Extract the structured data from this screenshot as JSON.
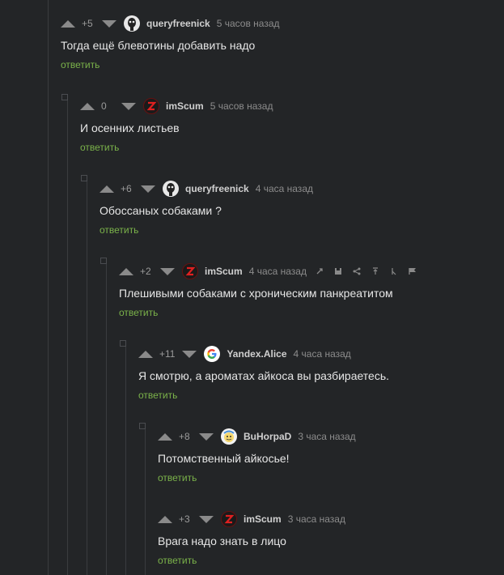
{
  "comments": [
    {
      "rating": "+5",
      "nick": "queryfreenick",
      "time": "5 часов назад",
      "text": "Тогда ещё блевотины добавить надо",
      "reply": "ответить",
      "avatar": "skull-avatar-icon"
    },
    {
      "rating": "0",
      "nick": "imScum",
      "time": "5 часов назад",
      "text": "И осенних листьев",
      "reply": "ответить",
      "avatar": "z-logo-avatar-icon"
    },
    {
      "rating": "+6",
      "nick": "queryfreenick",
      "time": "4 часа назад",
      "text": "Обоссаных собаками ?",
      "reply": "ответить",
      "avatar": "skull-avatar-icon"
    },
    {
      "rating": "+2",
      "nick": "imScum",
      "time": "4 часа назад",
      "text": "Плешивыми собаками с хроническим панкреатитом",
      "reply": "ответить",
      "avatar": "z-logo-avatar-icon"
    },
    {
      "rating": "+11",
      "nick": "Yandex.Alice",
      "time": "4 часа назад",
      "text": "Я смотрю, а ароматах айкоса вы разбираетесь.",
      "reply": "ответить",
      "avatar": "google-logo-avatar-icon"
    },
    {
      "rating": "+8",
      "nick": "BuHorpaD",
      "time": "3 часа назад",
      "text": "Потомственный айкосье!",
      "reply": "ответить",
      "avatar": "cartoon-avatar-icon"
    },
    {
      "rating": "+3",
      "nick": "imScum",
      "time": "3 часа назад",
      "text": "Врага надо знать в лицо",
      "reply": "ответить",
      "avatar": "z-logo-avatar-icon"
    }
  ],
  "colors": {
    "background": "#232527",
    "reply_link": "#7bb34a",
    "vote_arrow": "#8a8a8a",
    "thread_line": "#3a3c3f"
  },
  "toolbar_icons": [
    "link-icon",
    "save-icon",
    "share-icon",
    "scroll-to-top-icon",
    "parent-comment-icon",
    "report-flag-icon"
  ]
}
